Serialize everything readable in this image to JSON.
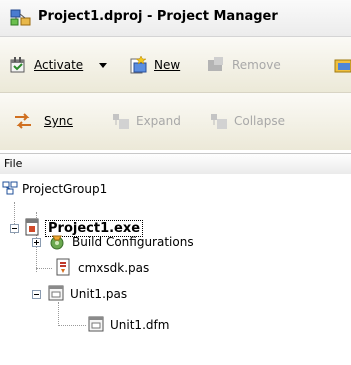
{
  "window": {
    "title": "Project1.dproj - Project Manager"
  },
  "toolbar1": {
    "activate_label": "Activate",
    "new_label": "New",
    "remove_label": "Remove"
  },
  "toolbar2": {
    "sync_label": "Sync",
    "expand_label": "Expand",
    "collapse_label": "Collapse"
  },
  "panel": {
    "header": "File"
  },
  "tree": {
    "group": "ProjectGroup1",
    "project": "Project1.exe",
    "build_configurations": "Build Configurations",
    "cmxsdk": "cmxsdk.pas",
    "unit_pas": "Unit1.pas",
    "unit_dfm": "Unit1.dfm"
  },
  "colors": {
    "toolbar_bg": "#ece9d8",
    "disabled_text": "#a8a8a8",
    "tree_bg": "#ffffff"
  },
  "icons": {
    "app": "project-manager-icon",
    "activate": "activate-icon",
    "new": "new-icon",
    "remove": "remove-icon",
    "sync": "sync-icon",
    "expand": "expand-icon",
    "collapse": "collapse-icon",
    "group": "project-group-icon",
    "project": "project-icon",
    "build": "build-configurations-icon",
    "pas": "pas-file-icon",
    "unit": "unit-icon",
    "form": "form-icon"
  }
}
